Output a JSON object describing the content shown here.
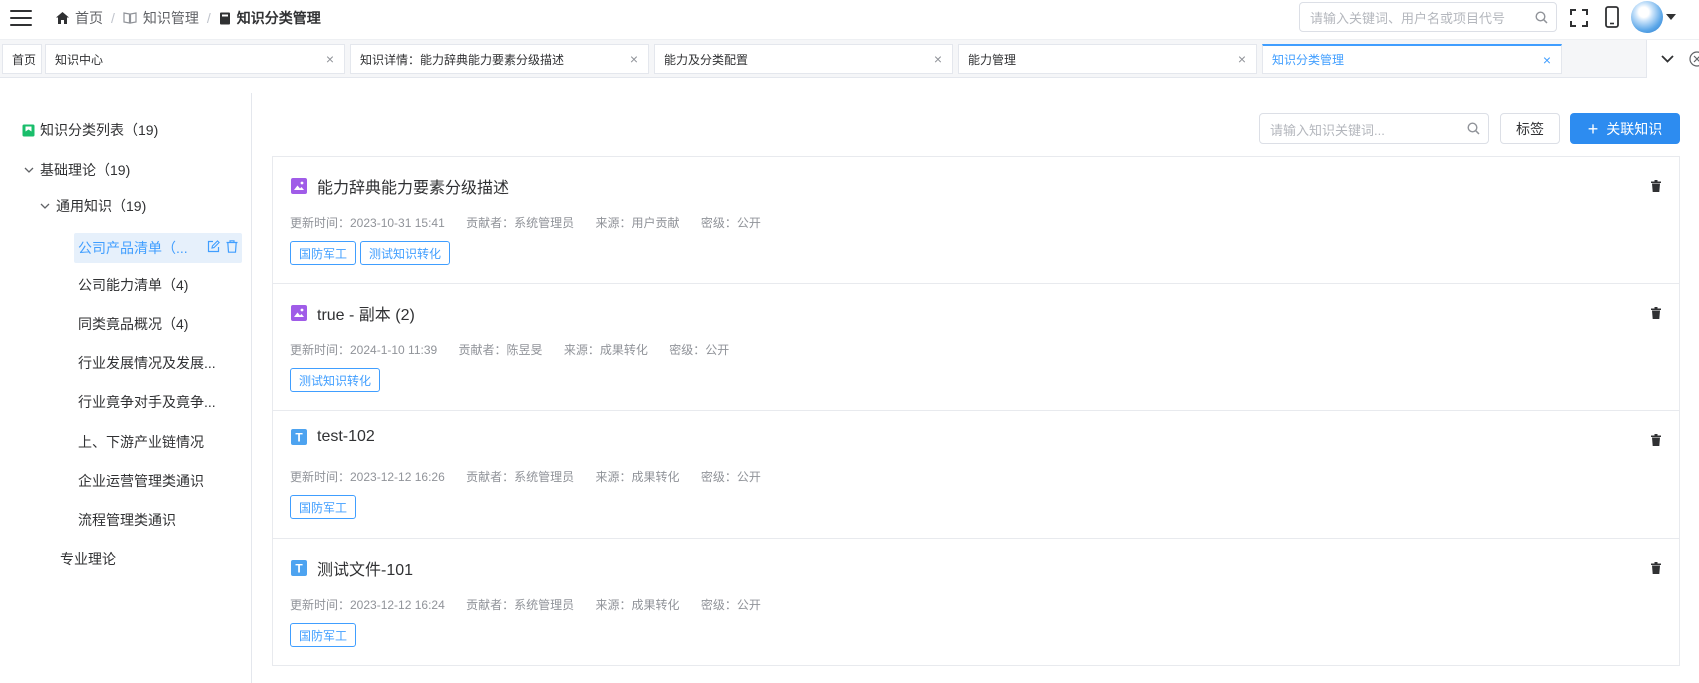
{
  "header": {
    "breadcrumb": [
      "首页",
      "知识管理",
      "知识分类管理"
    ],
    "breadcrumb_sep": "/",
    "search_placeholder": "请输入关键词、用户名或项目代号"
  },
  "tabs": [
    {
      "label": "首页",
      "closable": false
    },
    {
      "label": "知识中心",
      "closable": true
    },
    {
      "label": "知识详情：能力辞典能力要素分级描述",
      "closable": true
    },
    {
      "label": "能力及分类配置",
      "closable": true
    },
    {
      "label": "能力管理",
      "closable": true
    },
    {
      "label": "知识分类管理",
      "closable": true,
      "active": true
    }
  ],
  "tab_close_glyph": "×",
  "sidebar": {
    "root": "知识分类列表（19)",
    "nodes": [
      {
        "label": "基础理论（19)",
        "expanded": true
      },
      {
        "label": "通用知识（19)",
        "expanded": true
      },
      {
        "label": "公司产品清单（...",
        "active": true
      },
      {
        "label": "公司能力清单（4)"
      },
      {
        "label": "同类竟品概况（4)"
      },
      {
        "label": "行业发展情况及发展..."
      },
      {
        "label": "行业竟争对手及竟争..."
      },
      {
        "label": "上、下游产业链情况"
      },
      {
        "label": "企业运营管理类通识"
      },
      {
        "label": "流程管理类通识"
      },
      {
        "label": "专业理论"
      }
    ]
  },
  "toolbar": {
    "search_placeholder": "请输入知识关键词...",
    "tag_button": "标签",
    "link_button": "关联知识",
    "link_button_icon": "+"
  },
  "cards": [
    {
      "icon": "image-file-icon",
      "title": "能力辞典能力要素分级描述",
      "updated": "更新时间：2023-10-31 15:41",
      "contributor": "贡献者：系统管理员",
      "source": "来源：用户贡献",
      "secret": "密级：公开",
      "tags": [
        "国防军工",
        "测试知识转化"
      ]
    },
    {
      "icon": "image-file-icon",
      "title": "true - 副本 (2)",
      "updated": "更新时间：2024-1-10 11:39",
      "contributor": "贡献者：陈昱旻",
      "source": "来源：成果转化",
      "secret": "密级：公开",
      "tags": [
        "测试知识转化"
      ]
    },
    {
      "icon": "text-file-icon",
      "title": "test-102",
      "updated": "更新时间：2023-12-12 16:26",
      "contributor": "贡献者：系统管理员",
      "source": "来源：成果转化",
      "secret": "密级：公开",
      "tags": [
        "国防军工"
      ]
    },
    {
      "icon": "text-file-icon",
      "title": "测试文件-101",
      "updated": "更新时间：2023-12-12 16:24",
      "contributor": "贡献者：系统管理员",
      "source": "来源：成果转化",
      "secret": "密级：公开",
      "tags": [
        "国防军工"
      ]
    }
  ],
  "colors": {
    "accent": "#409eff",
    "primary_button": "#2d8cf0",
    "image_icon": "#a05ce8",
    "text_icon": "#4da3f0",
    "sidebar_root_icon": "#19be6b"
  },
  "text_icon_letter": "T"
}
